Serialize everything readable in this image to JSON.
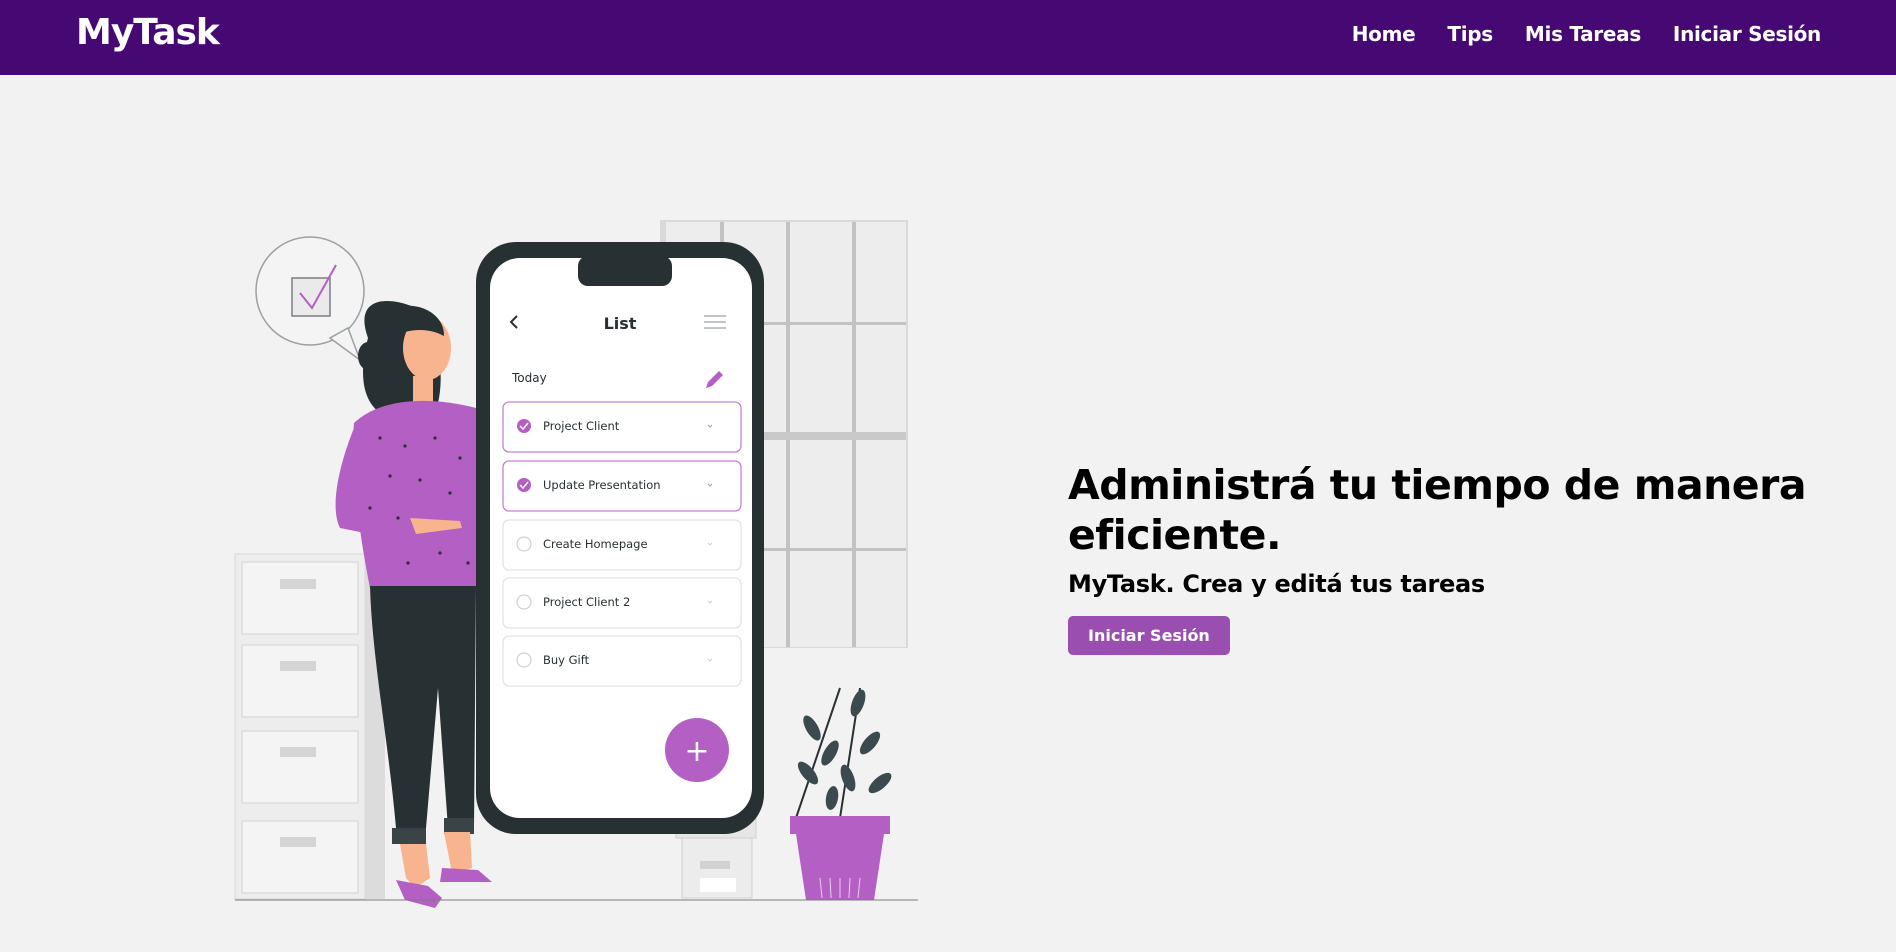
{
  "navbar": {
    "brand": "MyTask",
    "links": [
      {
        "label": "Home"
      },
      {
        "label": "Tips"
      },
      {
        "label": "Mis Tareas"
      },
      {
        "label": "Iniciar Sesión"
      }
    ]
  },
  "hero": {
    "title": "Administrá tu tiempo de manera eficiente.",
    "subtitle": "MyTask. Crea y editá tus tareas",
    "button_label": "Iniciar Sesión"
  },
  "illustration": {
    "phone_title": "List",
    "section_label": "Today",
    "tasks": [
      {
        "label": "Project Client",
        "done": true
      },
      {
        "label": "Update Presentation",
        "done": true
      },
      {
        "label": "Create Homepage",
        "done": false
      },
      {
        "label": "Project Client 2",
        "done": false
      },
      {
        "label": "Buy Gift",
        "done": false
      }
    ],
    "add_symbol": "+"
  },
  "colors": {
    "navbar": "#460872",
    "accent": "#9a4fb0",
    "illustration_purple": "#b35fc4",
    "background": "#f2f2f2"
  },
  "icons": [
    "back-arrow-icon",
    "menu-icon",
    "pencil-icon",
    "check-icon",
    "chevron-down-icon",
    "plus-icon",
    "checkbox-speech-bubble-icon"
  ]
}
